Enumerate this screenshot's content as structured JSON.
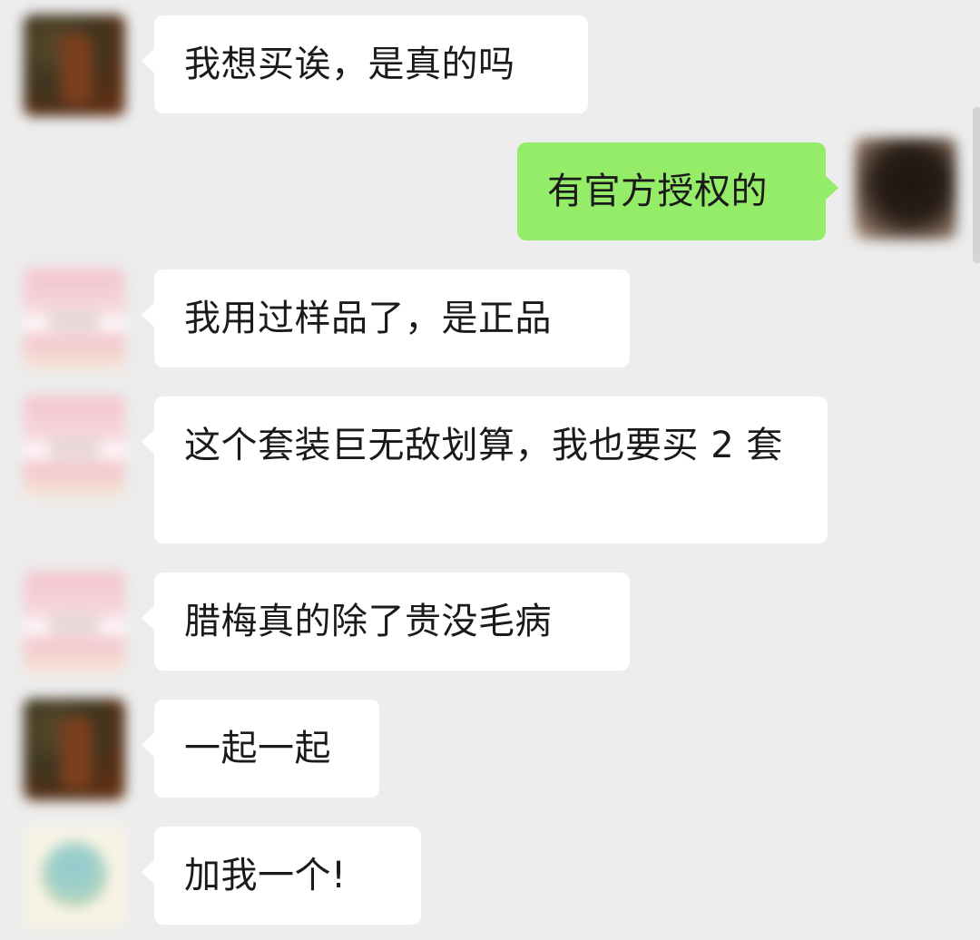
{
  "messages": [
    {
      "side": "left",
      "avatar": "avatar-brown",
      "text": "我想买诶，是真的吗"
    },
    {
      "side": "right",
      "avatar": "avatar-dark",
      "text": "有官方授权的"
    },
    {
      "side": "left",
      "avatar": "avatar-pink",
      "text": "我用过样品了，是正品"
    },
    {
      "side": "left",
      "avatar": "avatar-pink",
      "text": "这个套装巨无敌划算，我也要买 2 套"
    },
    {
      "side": "left",
      "avatar": "avatar-pink",
      "text": "腊梅真的除了贵没毛病"
    },
    {
      "side": "left",
      "avatar": "avatar-brown",
      "text": "一起一起"
    },
    {
      "side": "left",
      "avatar": "avatar-globe",
      "text": "加我一个!"
    }
  ],
  "colors": {
    "background": "#ededed",
    "incoming_bubble": "#ffffff",
    "outgoing_bubble": "#95ec69",
    "text": "#1a1a1a"
  }
}
